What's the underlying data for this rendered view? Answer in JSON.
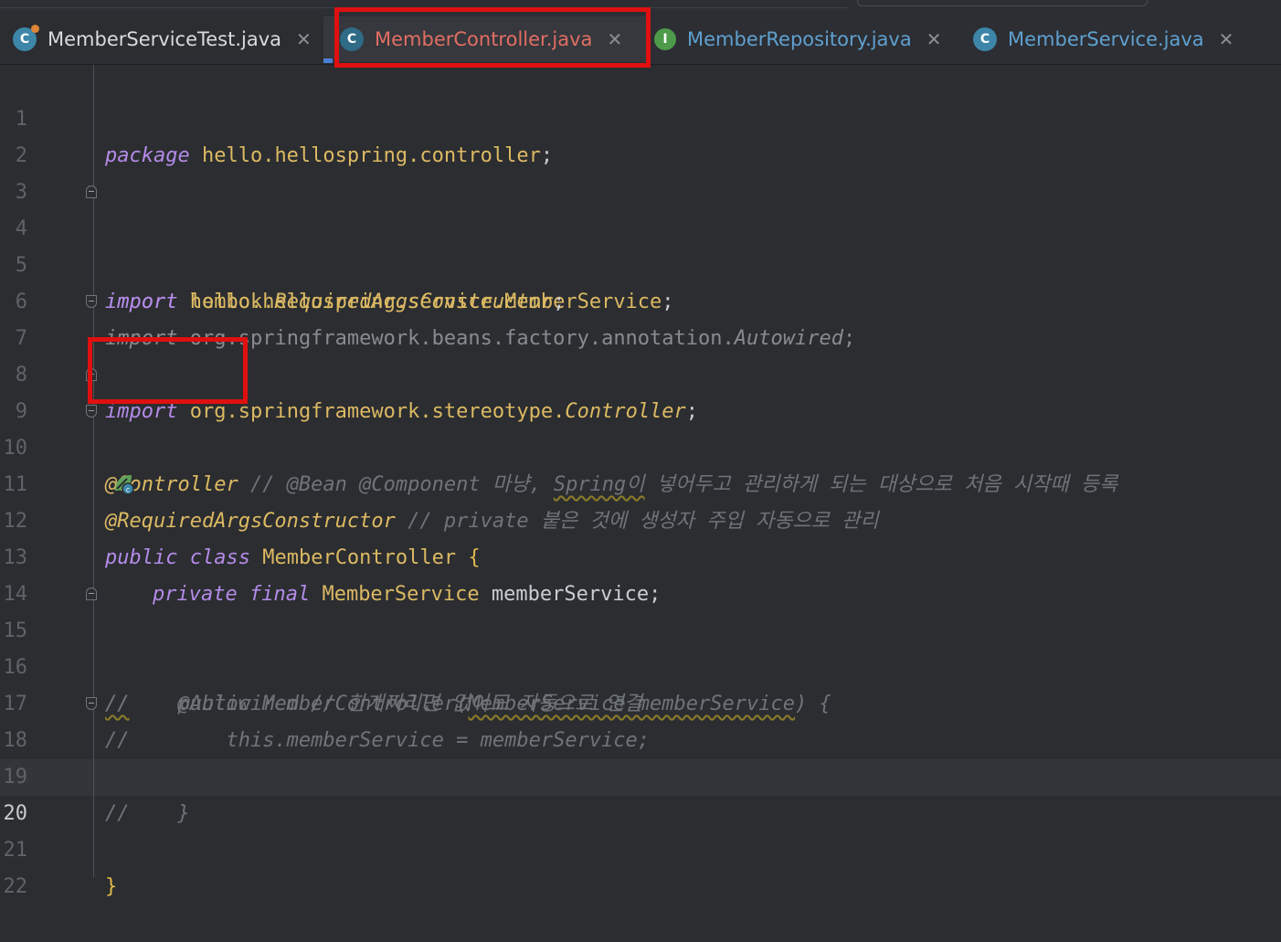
{
  "tabs": [
    {
      "name": "MemberServiceTest.java",
      "icon": "C",
      "active": false
    },
    {
      "name": "MemberController.java",
      "icon": "C",
      "active": true
    },
    {
      "name": "MemberRepository.java",
      "icon": "I",
      "active": false
    },
    {
      "name": "MemberService.java",
      "icon": "C",
      "active": false
    }
  ],
  "close_glyph": "✕",
  "line_numbers": [
    "1",
    "2",
    "3",
    "4",
    "5",
    "6",
    "7",
    "8",
    "9",
    "10",
    "11",
    "12",
    "13",
    "14",
    "15",
    "16",
    "17",
    "18",
    "19",
    "20",
    "21",
    "22"
  ],
  "current_line": "20",
  "code": {
    "l1": {
      "kw": "package",
      "rest": "hello.hellospring.controller",
      "semi": ";"
    },
    "l4": {
      "kw": "import",
      "rest": "hello.hellospring.service.MemberService",
      "semi": ";"
    },
    "l5": {
      "kw": "import",
      "pre": "lombok.",
      "cls": "RequiredArgsConstructor",
      "semi": ";"
    },
    "l6": {
      "kw": "import",
      "pre": "org.springframework.beans.factory.annotation.",
      "cls": "Autowired",
      "semi": ";"
    },
    "l7": {
      "kw": "import",
      "pre": "org.springframework.stereotype.",
      "cls": "Controller",
      "semi": ";"
    },
    "l9": {
      "ann": "@Controller",
      "comment_a": "// @Bean @Component 마냥, ",
      "comment_b": "Spring이",
      "comment_c": " 넣어두고 관리하게 되는 대상으로 처음 시작때 등록"
    },
    "l10": {
      "ann": "@RequiredArgsConstructor",
      "comment": "// private 붙은 것에 생성자 주입 자동으로 관리"
    },
    "l11": {
      "kw1": "public",
      "kw2": "class",
      "cls": "MemberController",
      "brace": "{"
    },
    "l13": {
      "kw1": "private",
      "kw2": "final",
      "cls": "MemberService",
      "field": "memberService",
      "semi": ";"
    },
    "l15": {
      "slash": "//",
      "rest": "    @Autowired // 한개짜리면 없어도 자동으로 연결"
    },
    "l16": {
      "slash": "//",
      "pre": "    public MemberController(",
      "param": "MemberService memberService",
      "post": ") {"
    },
    "l17": {
      "slash": "//",
      "rest": "        this.memberService = memberService;"
    },
    "l18": {
      "slash": "//",
      "rest": "    }"
    },
    "l21": {
      "brace": "}"
    }
  },
  "colors": {
    "highlight": "#e01010",
    "keyword": "#b48be8",
    "annotation": "#dcb963",
    "comment": "#6f737a"
  }
}
